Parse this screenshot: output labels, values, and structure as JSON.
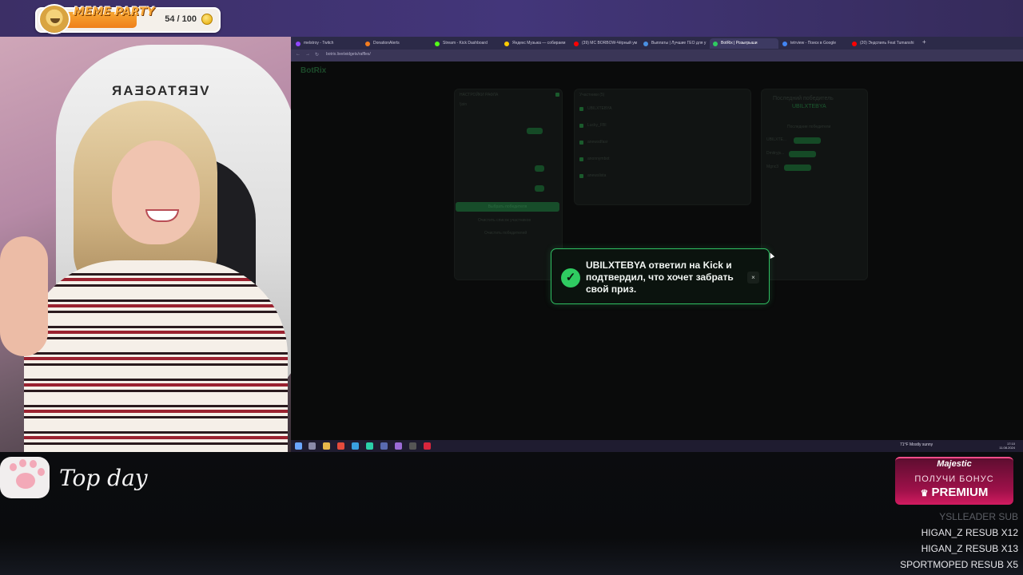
{
  "overlay": {
    "meme_title": "MEME PARTY",
    "meme_count": "54 / 100",
    "meme_progress": 0.54
  },
  "cam": {
    "chair_brand": "VERTAGEAR"
  },
  "browser": {
    "tabs": [
      {
        "label": "melstroy - Twitch",
        "color": "#9146ff"
      },
      {
        "label": "DonationAlerts",
        "color": "#f57c1f"
      },
      {
        "label": "Stream - Kick Dashboard",
        "color": "#53fc18"
      },
      {
        "label": "Яндекс Музыка — собираем",
        "color": "#ffcc00"
      },
      {
        "label": "(39) MC BORBOW-Чёрный ум",
        "color": "#ff0000"
      },
      {
        "label": "Выплаты | Лучшие ГЕО для у",
        "color": "#4a90e2"
      },
      {
        "label": "BotRix | Розыгрыши",
        "color": "#2fcb61"
      },
      {
        "label": "tetrview - Поиск в Google",
        "color": "#4285f4"
      },
      {
        "label": "(20) Эндспиль Feat Tumanshi",
        "color": "#ff0000"
      }
    ],
    "active_tab": 6,
    "url": "botrix.live/widgets/raffles/"
  },
  "app": {
    "brand": "BotRix",
    "raffle_panel_title": "НАСТРОЙКИ РАФЛА",
    "keyword_value": "!join",
    "participants_title": "Участники (5)",
    "participants": [
      "UBILXTEBYA",
      "Lucky_FBI",
      "anewsdfasr",
      "anonnymbot",
      "anewslista"
    ],
    "start_button": "Выбрать победителя",
    "clear_link": "Очистить список участников",
    "clear_winners": "Очистить победителей",
    "last_winner_title": "Последний победитель",
    "last_winner_name": "UBILXTEBYA",
    "previous_winners_title": "Последние победители",
    "previous_winners": [
      "UBILXTE...",
      "Dmitryjs...",
      "Mgnc3"
    ]
  },
  "toast": {
    "message": "UBILXTEBYA ответил на Kick и подтвердил, что хочет забрать свой приз.",
    "close": "×",
    "icon": "check-icon"
  },
  "taskbar": {
    "weather": "71°F  Mostly sunny",
    "time": "17:10",
    "date": "11.08.2024"
  },
  "bottom": {
    "caption": "Top day",
    "promo_brand": "Majestic",
    "promo_line1": "ПОЛУЧИ БОНУС",
    "promo_line2": "PREMIUM",
    "events": [
      {
        "text": "YSLLEADER  SUB",
        "faded": true
      },
      {
        "text": "HIGAN_Z  RESUB X12",
        "faded": false
      },
      {
        "text": "HIGAN_Z  RESUB X13",
        "faded": false
      },
      {
        "text": "SPORTMOPED  RESUB X5",
        "faded": false
      }
    ]
  }
}
